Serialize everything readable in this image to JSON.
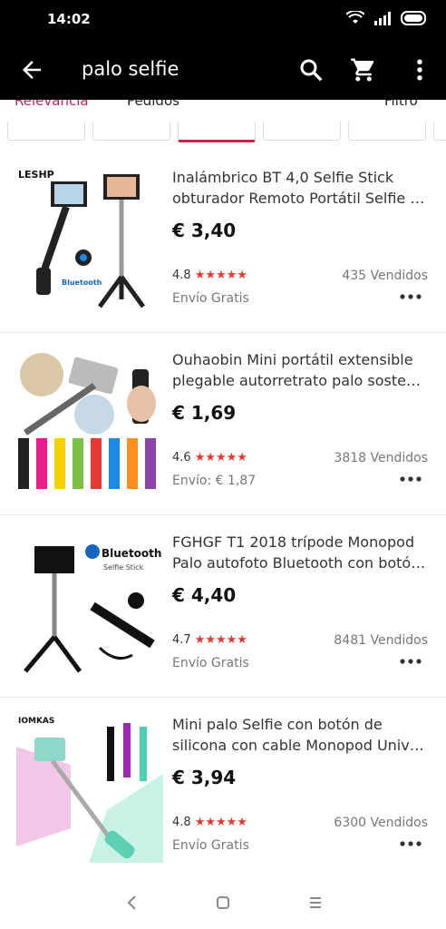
{
  "status": {
    "time": "14:02"
  },
  "appbar": {
    "query": "palo selfie"
  },
  "tabs": [
    "Relevancia",
    "Pedidos",
    "Filtro"
  ],
  "products": [
    {
      "brand": "LESHP",
      "title_line1": "Inalámbrico BT 4,0 Selfie Stick",
      "title_line2": "obturador Remoto Portátil Selfie Sti...",
      "price": "€ 3,40",
      "rating": "4.8",
      "sold": "435 Vendidos",
      "shipping": "Envío Gratis"
    },
    {
      "brand": "",
      "title_line1": "Ouhaobin Mini portátil extensible",
      "title_line2": "plegable autorretrato palo sostene...",
      "price": "€ 1,69",
      "rating": "4.6",
      "sold": "3818 Vendidos",
      "shipping": "Envío: € 1,87"
    },
    {
      "brand": "Bluetooth",
      "title_line1": "FGHGF T1 2018 trípode Monopod",
      "title_line2": "Palo autofoto Bluetooth con botón ...",
      "price": "€ 4,40",
      "rating": "4.7",
      "sold": "8481 Vendidos",
      "shipping": "Envío Gratis"
    },
    {
      "brand": "IOMKAS",
      "title_line1": "Mini palo Selfie con botón de",
      "title_line2": "silicona con cable Monopod Univer...",
      "price": "€ 3,94",
      "rating": "4.8",
      "sold": "6300 Vendidos",
      "shipping": "Envío Gratis"
    }
  ],
  "colors": {
    "accent": "#c0254d",
    "star": "#e4392e"
  }
}
